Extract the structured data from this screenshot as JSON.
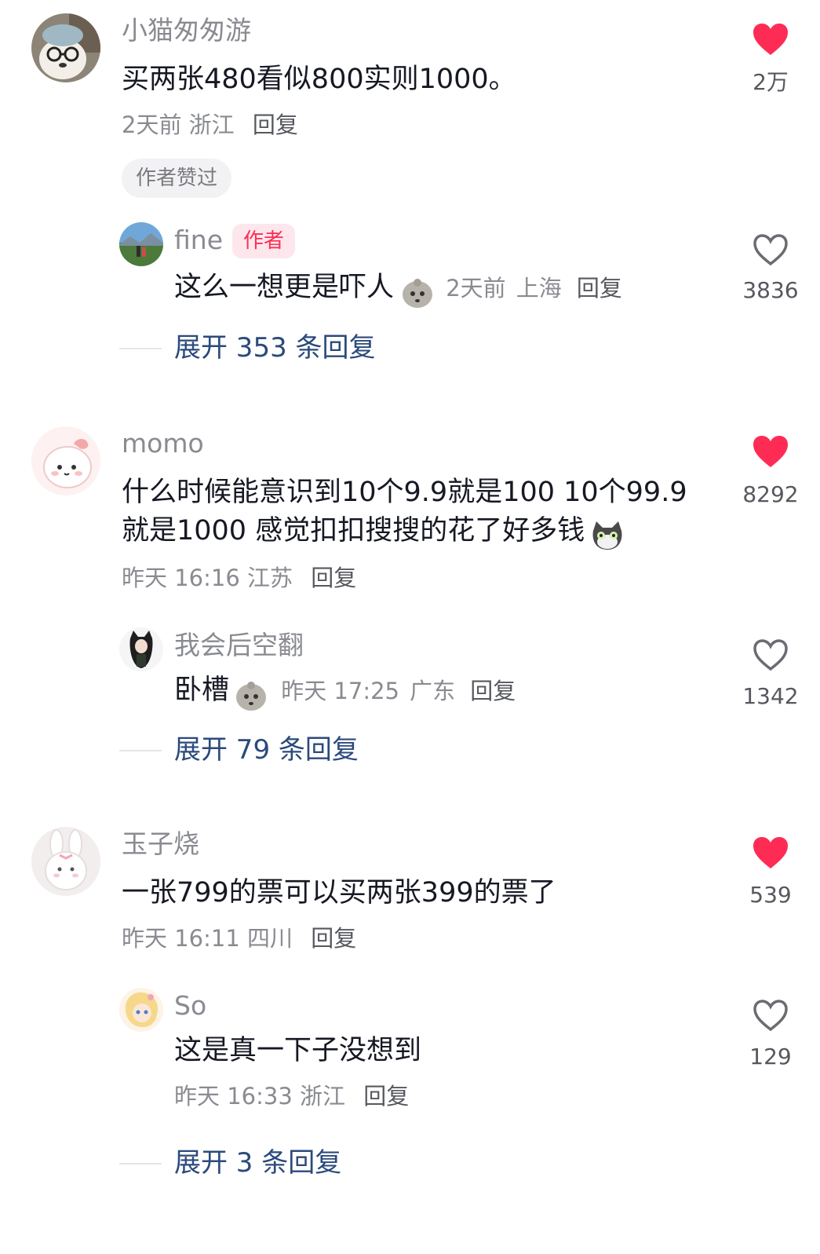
{
  "colors": {
    "like_red": "#fe2c55",
    "meta_gray": "#8a8b91",
    "link_blue": "#2b4a7c",
    "author_tag_bg": "#fde7ec"
  },
  "comments": [
    {
      "username": "小猫匆匆游",
      "text": "买两张480看似800实则1000。",
      "time": "2天前",
      "location": "浙江",
      "reply_label": "回复",
      "likes": "2万",
      "liked": true,
      "liked_by_author_label": "作者赞过",
      "avatar_icon": "avatar-dog-glasses",
      "reply": {
        "username": "fine",
        "author_tag": "作者",
        "text": "这么一想更是吓人",
        "emoji_icon": "emoji-scared-blob",
        "time": "2天前",
        "location": "上海",
        "reply_label": "回复",
        "likes": "3836",
        "liked": false,
        "avatar_icon": "avatar-landscape"
      },
      "expand_label": "展开 353 条回复"
    },
    {
      "username": "momo",
      "text_line1": "什么时候能意识到10个9.9就是100  10个99.9",
      "text_line2": "就是1000  感觉扣扣搜搜的花了好多钱",
      "emoji_icon": "emoji-cat-face",
      "time": "昨天 16:16",
      "location": "江苏",
      "reply_label": "回复",
      "likes": "8292",
      "liked": true,
      "avatar_icon": "avatar-pink-cartoon",
      "reply": {
        "username": "我会后空翻",
        "text": "卧槽",
        "emoji_icon": "emoji-scared-blob",
        "time": "昨天 17:25",
        "location": "广东",
        "reply_label": "回复",
        "likes": "1342",
        "liked": false,
        "avatar_icon": "avatar-girl-cat-ears"
      },
      "expand_label": "展开 79 条回复"
    },
    {
      "username": "玉子烧",
      "text": "一张799的票可以买两张399的票了",
      "time": "昨天 16:11",
      "location": "四川",
      "reply_label": "回复",
      "likes": "539",
      "liked": true,
      "avatar_icon": "avatar-bunny",
      "reply": {
        "username": "So",
        "text": "这是真一下子没想到",
        "time": "昨天 16:33",
        "location": "浙江",
        "reply_label": "回复",
        "likes": "129",
        "liked": false,
        "avatar_icon": "avatar-anime-girl"
      },
      "expand_label": "展开 3 条回复"
    }
  ]
}
